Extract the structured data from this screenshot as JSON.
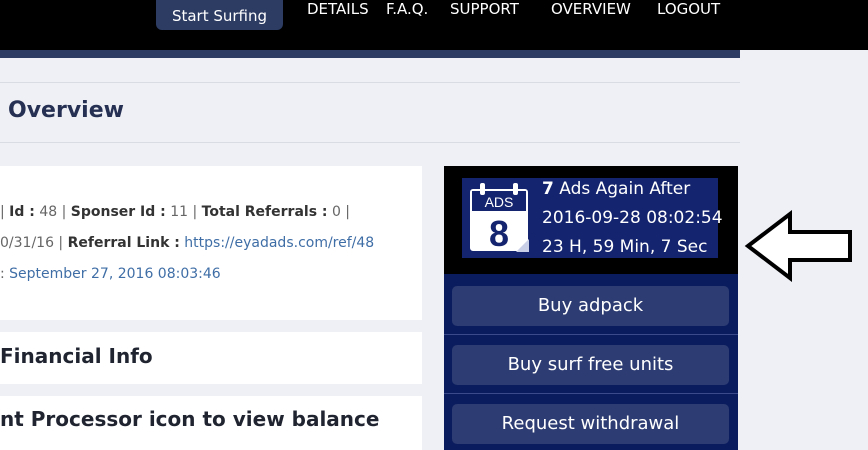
{
  "nav": {
    "start_label": "Start Surfing",
    "items": [
      "DETAILS",
      "F.A.Q.",
      "SUPPORT",
      "OVERVIEW",
      "LOGOUT"
    ]
  },
  "page": {
    "title": "Overview"
  },
  "account": {
    "line1": {
      "pre": "| ",
      "id_label": "Id :",
      "id_value": " 48 | ",
      "sponsor_label": "Sponser Id :",
      "sponsor_value": " 11 | ",
      "referrals_label": "Total Referrals :",
      "referrals_value": " 0 |"
    },
    "line2": {
      "pre": "0/31/16 | ",
      "ref_label": "Referral Link :",
      "ref_url": " https://eyadads.com/ref/48"
    },
    "line3": {
      "pre": ": ",
      "date": "September 27, 2016 08:03:46"
    }
  },
  "sections": {
    "financial": "Financial Info",
    "processor": "nt Processor icon to view balance"
  },
  "ads_panel": {
    "icon_label": "ADS",
    "icon_number": "8",
    "count": "7",
    "again_text": " Ads Again After",
    "datetime": "2016-09-28 08:02:54",
    "countdown": "23 H, 59 Min, 7 Sec"
  },
  "actions": {
    "buy_adpack": "Buy adpack",
    "buy_surf": "Buy surf free units",
    "withdraw": "Request withdrawal"
  },
  "colors": {
    "nav_bg": "#000000",
    "accent_navy": "#2d3c63",
    "panel_bg": "#0a1c5e",
    "title": "#253052",
    "link": "#3f6ea6"
  },
  "icons": [
    "calendar-ads-icon",
    "left-arrow-icon"
  ]
}
